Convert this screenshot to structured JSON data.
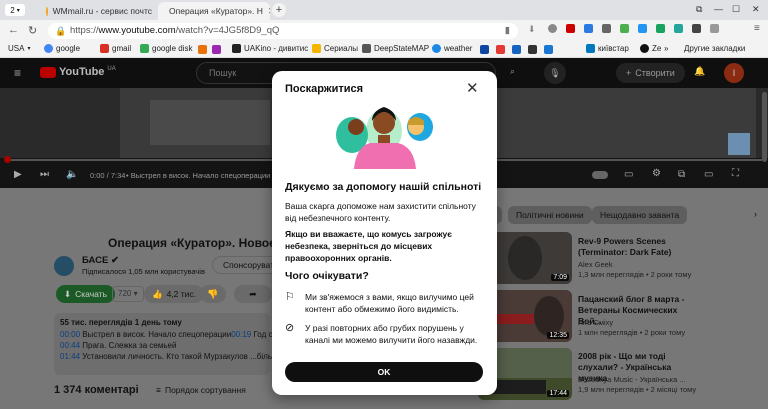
{
  "browser": {
    "tab_count": "2",
    "tabs": [
      {
        "title": "WMmail.ru - сервис почтс",
        "active": false
      },
      {
        "title": "Операция «Куратор». Н",
        "active": true
      }
    ],
    "url_prefix": "https://",
    "url_host": "www.youtube.com",
    "url_path": "/watch?v=4JG5f8D9_qQ",
    "bookmarks": [
      "USA",
      "google",
      "gmail",
      "google disk",
      "UAKino - дивитис",
      "Сериалы",
      "DeepStateMAP",
      "weather",
      "київстар",
      "Ze"
    ],
    "other_bookmarks": "Другие закладки"
  },
  "youtube": {
    "logo": "YouTube",
    "region": "UA",
    "search_placeholder": "Пошук",
    "create_label": "Створити",
    "avatar_letter": "I",
    "time": "0:00 / 7:34",
    "chapter": "• Выстрел в висок. Начало спецоперации",
    "video_title": "Операция «Куратор». Новое им",
    "channel_name": "БАСЕ",
    "subscribers": "Підписалося 1,05 млн користувачів",
    "sponsor_label": "Спонсорувати",
    "download_label": "Скачать",
    "quality": "720",
    "likes": "4,2 тис.",
    "description_stats": "55 тис. переглядів  1 день тому",
    "chapters": [
      {
        "time": "00:00",
        "text": "Выстрел в висок. Начало спецоперации"
      },
      {
        "time": "00:44",
        "text": "Прага. Слежка за семьей"
      },
      {
        "time": "01:44",
        "text": "Установили личность. Кто такой Мурзакулов ...більше"
      }
    ],
    "chapter_1_extra": "Год ст",
    "chapter_1_extra_time": "00:19",
    "comments_count": "1 374 коментарі",
    "sort_label": "Порядок сортування",
    "chips": [
      "Політичні новини",
      "Нещодавно заванта"
    ],
    "recommendations": [
      {
        "title": "Rev-9 Powers Scenes (Terminator: Dark Fate)",
        "channel": "Alex Geek",
        "meta": "1,3 млн переглядів • 2 роки тому",
        "duration": "7:09"
      },
      {
        "title": "Пацанский блог 8 марта - Ветераны Космических Вой...",
        "channel": "Ліга Сміху",
        "meta": "1 млн переглядів • 2 роки тому",
        "duration": "12:35"
      },
      {
        "title": "2008 рік - Що ми тоді слухали? - Українська музика",
        "channel": "Bezodnya Music - Українська ...",
        "meta": "1,9 млн переглядів • 2 місяці тому",
        "duration": "17:44"
      }
    ]
  },
  "modal": {
    "title": "Поскаржитися",
    "thanks": "Дякуємо за допомогу нашій спільноті",
    "body1": "Ваша скарга допоможе нам захистити спільноту від небезпечного контенту.",
    "body2": "Якщо ви вважаєте, що комусь загрожує небезпека, зверніться до місцевих правоохоронних органів.",
    "expect_title": "Чого очікувати?",
    "items": [
      {
        "icon": "flag-icon",
        "text": "Ми зв'яжемося з вами, якщо вилучимо цей контент або обмежимо його видимість."
      },
      {
        "icon": "block-icon",
        "text": "У разі повторних або грубих порушень у каналі ми можемо вилучити його назавжди."
      }
    ],
    "ok_label": "OK"
  },
  "colors": {
    "yt_red": "#ff0000",
    "download_green": "#2ba640",
    "chapter_link": "#3ea6ff"
  }
}
